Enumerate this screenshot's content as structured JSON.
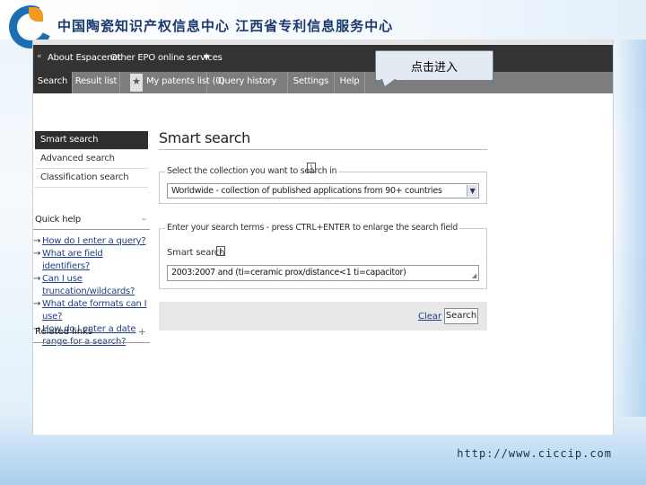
{
  "slide": {
    "title": "中国陶瓷知识产权信息中心  江西省专利信息服务中心",
    "footer_url": "http://www.ciccip.com"
  },
  "topbar": {
    "back_icon": "«",
    "about_link": "About Espacenet",
    "services_link": "Other EPO online services",
    "services_caret": "▼"
  },
  "tabs": {
    "search": "Search",
    "results": "Result list",
    "patents": "My patents list (0)",
    "history": "Query history",
    "settings": "Settings",
    "help": "Help",
    "active": "search"
  },
  "callout": {
    "text": "点击进入"
  },
  "sidebar": {
    "items": [
      {
        "label": "Smart search",
        "active": true
      },
      {
        "label": "Advanced search",
        "active": false
      },
      {
        "label": "Classification search",
        "active": false
      }
    ],
    "quick_help": {
      "title": "Quick help",
      "toggle": "–",
      "links": [
        "How do I enter a query?",
        "What are field identifiers?",
        "Can I use truncation/wildcards?",
        "What date formats can I use?",
        "How do I enter a date range for a search?"
      ]
    },
    "related_links": {
      "title": "Related links",
      "toggle": "+"
    }
  },
  "main": {
    "title": "Smart search",
    "collection_legend": "Select the collection you want to search in",
    "collection_value": "Worldwide - collection of published applications from 90+ countries",
    "terms_legend": "Enter your search terms - press CTRL+ENTER to enlarge the search field",
    "smart_search_label": "Smart search",
    "query_value": "2003:2007 and (ti=ceramic prox/distance<1 ti=capacitor)",
    "clear_label": "Clear",
    "search_button": "Search"
  }
}
